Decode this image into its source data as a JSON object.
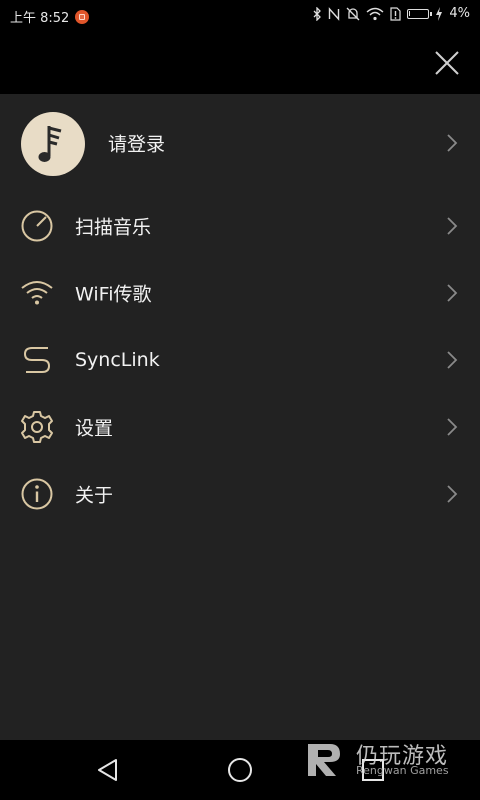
{
  "status_bar": {
    "time": "上午 8:52",
    "battery_percent_label": "4%",
    "battery_level": 0.04,
    "icons": [
      "bluetooth-icon",
      "nfc-icon",
      "alarm-off-icon",
      "wifi-icon",
      "sim-alert-icon",
      "battery-icon",
      "charging-icon"
    ]
  },
  "header": {
    "close_icon": "close-icon"
  },
  "menu": {
    "login_label": "请登录",
    "items": [
      {
        "id": "scan-music",
        "label": "扫描音乐",
        "icon": "scan-dial-icon"
      },
      {
        "id": "wifi-transfer",
        "label": "WiFi传歌",
        "icon": "wifi-icon"
      },
      {
        "id": "synclink",
        "label": "SyncLink",
        "icon": "synclink-icon"
      },
      {
        "id": "settings",
        "label": "设置",
        "icon": "gear-icon"
      },
      {
        "id": "about",
        "label": "关于",
        "icon": "info-icon"
      }
    ]
  },
  "watermark": {
    "cn": "仍玩游戏",
    "en": "Rengwan Games"
  },
  "colors": {
    "background_dark": "#000000",
    "menu_bg": "#222222",
    "accent_gold": "#d9c7a3",
    "avatar_bg": "#e8dcc6",
    "chevron": "#8a8a8a",
    "notification_orange": "#e0552a"
  }
}
